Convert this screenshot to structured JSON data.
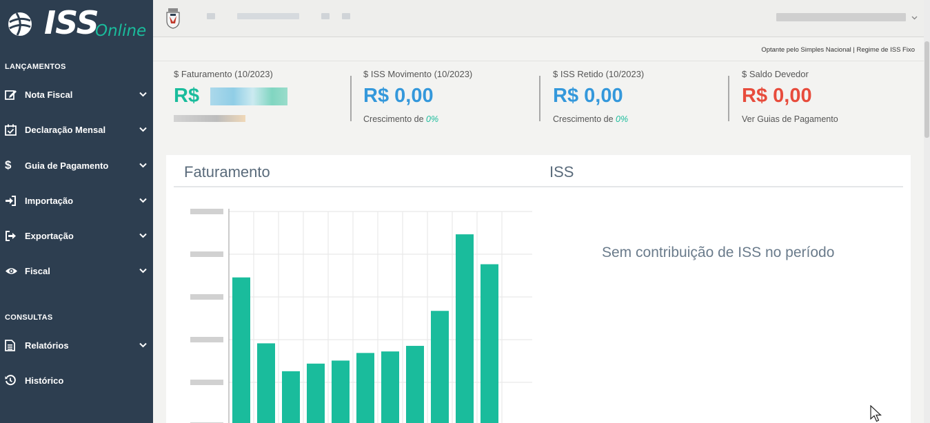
{
  "brand": {
    "name": "ISS",
    "suffix": "Online"
  },
  "sidebar": {
    "section_lancamentos": "LANÇAMENTOS",
    "section_consultas": "CONSULTAS",
    "items": [
      {
        "label": "Nota Fiscal",
        "icon": "edit-icon"
      },
      {
        "label": "Declaração Mensal",
        "icon": "calendar-check-icon"
      },
      {
        "label": "Guia de Pagamento",
        "icon": "dollar-icon"
      },
      {
        "label": "Importação",
        "icon": "sign-in-icon"
      },
      {
        "label": "Exportação",
        "icon": "sign-out-icon"
      },
      {
        "label": "Fiscal",
        "icon": "eye-icon"
      },
      {
        "label": "Relatórios",
        "icon": "document-icon"
      },
      {
        "label": "Histórico",
        "icon": "history-icon"
      }
    ]
  },
  "topbar": {
    "regime": "Optante pelo Simples Nacional | Regime de ISS Fixo"
  },
  "stats": [
    {
      "label": "$ Faturamento (10/2023)",
      "value": "R$",
      "sub": "",
      "color": "#1abc9c"
    },
    {
      "label": "$ ISS Movimento (10/2023)",
      "value": "R$ 0,00",
      "sub_prefix": "Crescimento de ",
      "sub_value": "0%",
      "color": "#3498db"
    },
    {
      "label": "$ ISS Retido (10/2023)",
      "value": "R$ 0,00",
      "sub_prefix": "Crescimento de ",
      "sub_value": "0%",
      "color": "#3498db"
    },
    {
      "label": "$ Saldo Devedor",
      "value": "R$ 0,00",
      "sub_prefix": "Ver Guias de Pagamento",
      "sub_value": "",
      "color": "#e74c3c"
    }
  ],
  "panel": {
    "title_faturamento": "Faturamento",
    "title_iss": "ISS",
    "empty_iss": "Sem contribuição de ISS no período"
  },
  "chart_data": {
    "type": "bar",
    "categories": [
      "",
      "",
      "",
      "",
      "",
      "",
      "",
      "",
      "",
      "",
      ""
    ],
    "values": [
      57,
      44,
      38.5,
      40,
      40.6,
      42.1,
      42.4,
      43.5,
      50.4,
      65.5,
      59.6
    ],
    "ylim": [
      20,
      70
    ],
    "grid": true,
    "color": "#1abc9c"
  },
  "colors": {
    "sidebar_bg": "#2d3e50",
    "accent": "#1abc9c",
    "blue": "#3498db",
    "red": "#e74c3c"
  }
}
